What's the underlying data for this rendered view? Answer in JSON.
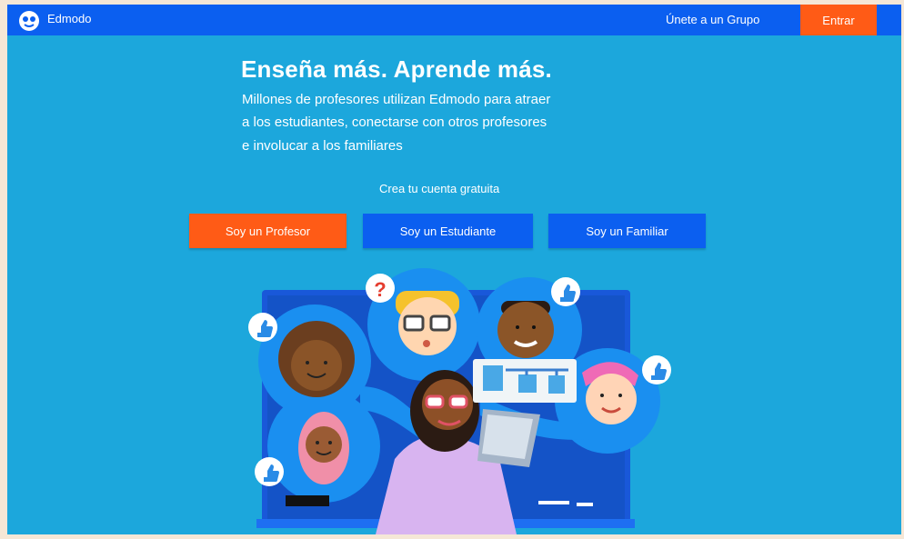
{
  "header": {
    "brand": "Edmodo",
    "join_group": "Únete a un Grupo",
    "login": "Entrar"
  },
  "hero": {
    "title": "Enseña más. Aprende más.",
    "description_lines": [
      "Millones de profesores utilizan Edmodo para atraer",
      "a los estudiantes, conectarse con otros profesores",
      "e involucar a los familiares"
    ],
    "subtitle": "Crea tu cuenta gratuita"
  },
  "actions": {
    "teacher": "Soy un Profesor",
    "student": "Soy un Estudiante",
    "family": "Soy un Familiar"
  },
  "colors": {
    "background": "#1ca7dc",
    "nav": "#0b5ff0",
    "accent": "#ff5b16",
    "bubble": "#1a8ff0"
  },
  "icons": {
    "logo": "edmodo-logo",
    "question": "question-mark-icon",
    "thumbs": "thumbs-up-icon"
  }
}
